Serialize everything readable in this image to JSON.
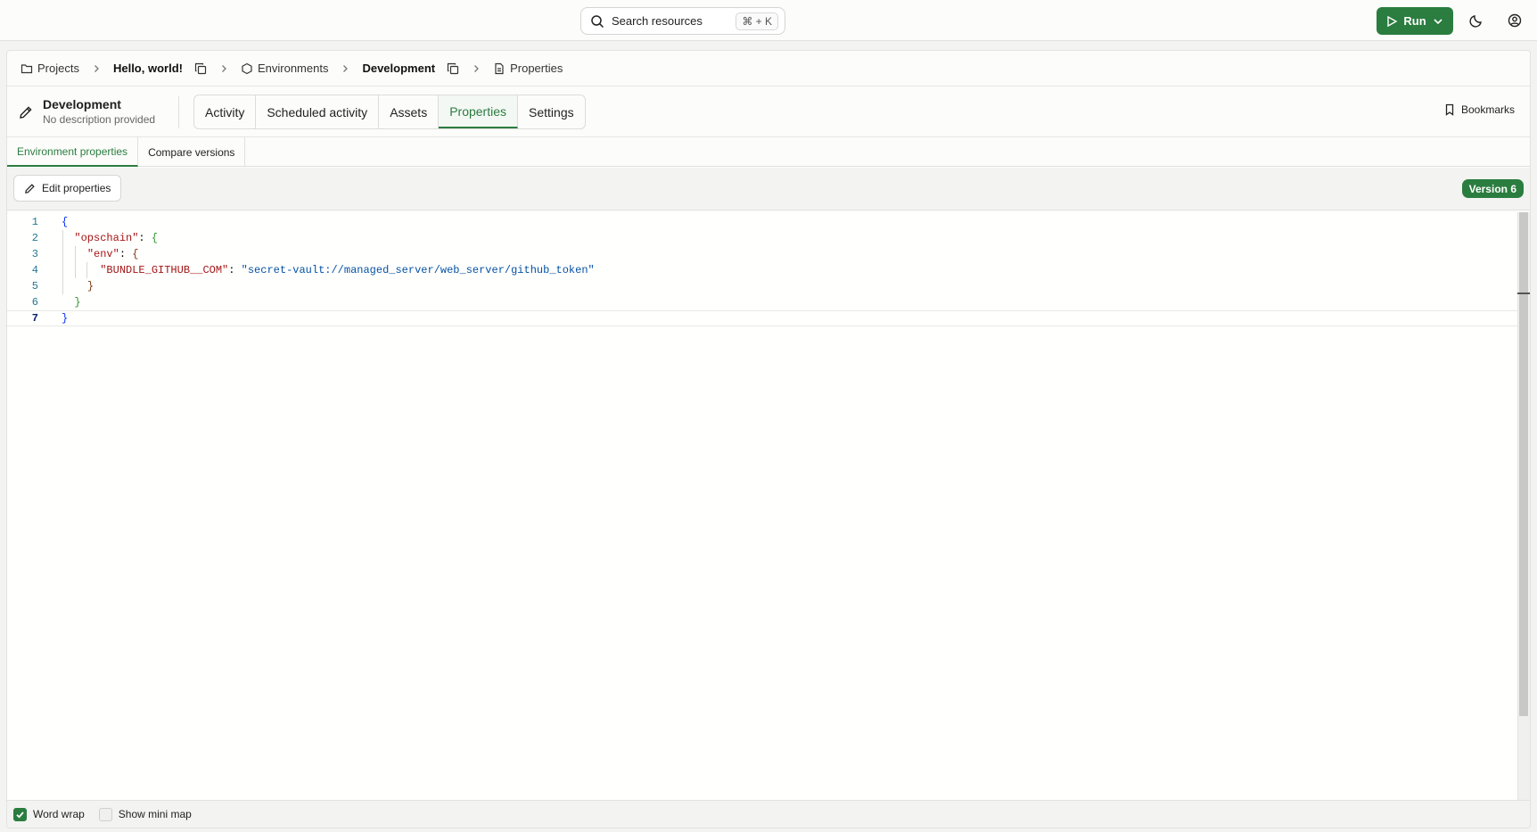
{
  "search": {
    "placeholder": "Search resources",
    "shortcut": "⌘ + K"
  },
  "run_button": {
    "label": "Run"
  },
  "breadcrumb": {
    "projects": "Projects",
    "project": "Hello, world!",
    "environments": "Environments",
    "environment": "Development",
    "properties": "Properties"
  },
  "environment": {
    "name": "Development",
    "description": "No description provided"
  },
  "tabs": [
    "Activity",
    "Scheduled activity",
    "Assets",
    "Properties",
    "Settings"
  ],
  "active_tab": "Properties",
  "bookmarks_label": "Bookmarks",
  "subtabs": [
    "Environment properties",
    "Compare versions"
  ],
  "edit_button": "Edit properties",
  "version_badge": "Version 6",
  "editor": {
    "line_numbers": [
      "1",
      "2",
      "3",
      "4",
      "5",
      "6",
      "7"
    ],
    "lines": [
      "{",
      "  \"opschain\": {",
      "    \"env\": {",
      "      \"BUNDLE_GITHUB__COM\": \"secret-vault://managed_server/web_server/github_token\"",
      "    }",
      "  }",
      "}"
    ],
    "tokens": {
      "opschain_key": "\"opschain\"",
      "env_key": "\"env\"",
      "bundle_key": "\"BUNDLE_GITHUB__COM\"",
      "bundle_value": "\"secret-vault://managed_server/web_server/github_token\"",
      "open_brace": "{",
      "close_brace": "}",
      "colon": ": ",
      "colon_nospace": ":"
    }
  },
  "footer": {
    "word_wrap": "Word wrap",
    "show_mini_map": "Show mini map",
    "word_wrap_checked": true,
    "mini_map_checked": false
  },
  "colors": {
    "accent": "#2a7d3f"
  }
}
